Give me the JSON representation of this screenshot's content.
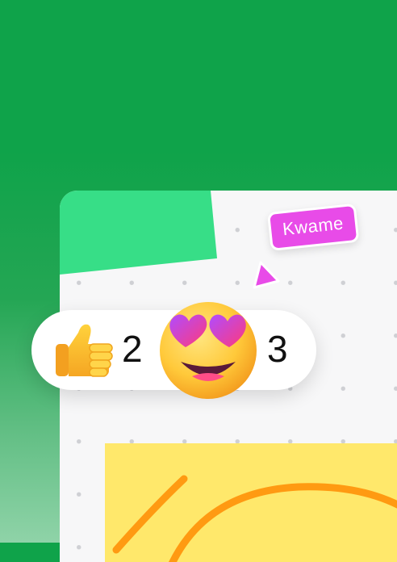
{
  "collaborator": {
    "name": "Kwame",
    "color": "#e84be8"
  },
  "reactions": [
    {
      "icon": "thumbs-up-icon",
      "count": "2"
    },
    {
      "icon": "heart-eyes-icon",
      "count": "3"
    }
  ],
  "colors": {
    "background": "#0fa34a",
    "green_note": "#37de87",
    "yellow_note": "#ffe86b",
    "drawing_stroke": "#ff9a12"
  }
}
